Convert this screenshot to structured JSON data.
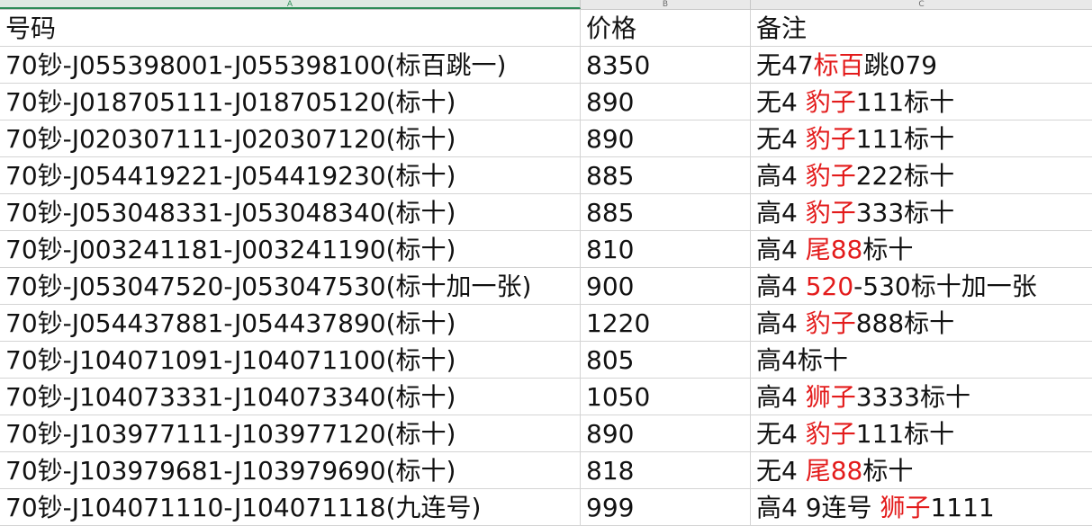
{
  "column_headers": [
    "A",
    "B",
    "C"
  ],
  "header_row": {
    "number": "号码",
    "price": "价格",
    "note": "备注"
  },
  "rows": [
    {
      "number": "70钞-J055398001-J055398100(标百跳一)",
      "price": "8350",
      "note": [
        {
          "t": "无47",
          "red": false
        },
        {
          "t": "标百",
          "red": true
        },
        {
          "t": "跳079",
          "red": false
        }
      ]
    },
    {
      "number": "70钞-J018705111-J018705120(标十)",
      "price": "890",
      "note": [
        {
          "t": "无4 ",
          "red": false
        },
        {
          "t": "豹子",
          "red": true
        },
        {
          "t": "111标十",
          "red": false
        }
      ]
    },
    {
      "number": "70钞-J020307111-J020307120(标十)",
      "price": "890",
      "note": [
        {
          "t": "无4 ",
          "red": false
        },
        {
          "t": "豹子",
          "red": true
        },
        {
          "t": "111标十",
          "red": false
        }
      ]
    },
    {
      "number": "70钞-J054419221-J054419230(标十)",
      "price": "885",
      "note": [
        {
          "t": "高4 ",
          "red": false
        },
        {
          "t": "豹子",
          "red": true
        },
        {
          "t": "222标十",
          "red": false
        }
      ]
    },
    {
      "number": "70钞-J053048331-J053048340(标十)",
      "price": "885",
      "note": [
        {
          "t": "高4 ",
          "red": false
        },
        {
          "t": "豹子",
          "red": true
        },
        {
          "t": "333标十",
          "red": false
        }
      ]
    },
    {
      "number": "70钞-J003241181-J003241190(标十)",
      "price": "810",
      "note": [
        {
          "t": "高4 ",
          "red": false
        },
        {
          "t": "尾88",
          "red": true
        },
        {
          "t": "标十",
          "red": false
        }
      ]
    },
    {
      "number": "70钞-J053047520-J053047530(标十加一张)",
      "price": "900",
      "note": [
        {
          "t": "高4 ",
          "red": false
        },
        {
          "t": "520",
          "red": true
        },
        {
          "t": "-530标十加一张",
          "red": false
        }
      ]
    },
    {
      "number": "70钞-J054437881-J054437890(标十)",
      "price": "1220",
      "note": [
        {
          "t": "高4 ",
          "red": false
        },
        {
          "t": "豹子",
          "red": true
        },
        {
          "t": "888标十",
          "red": false
        }
      ]
    },
    {
      "number": "70钞-J104071091-J104071100(标十)",
      "price": "805",
      "note": [
        {
          "t": "高4标十",
          "red": false
        }
      ]
    },
    {
      "number": "70钞-J104073331-J104073340(标十)",
      "price": "1050",
      "note": [
        {
          "t": "高4 ",
          "red": false
        },
        {
          "t": "狮子",
          "red": true
        },
        {
          "t": "3333标十",
          "red": false
        }
      ]
    },
    {
      "number": "70钞-J103977111-J103977120(标十)",
      "price": "890",
      "note": [
        {
          "t": "无4 ",
          "red": false
        },
        {
          "t": "豹子",
          "red": true
        },
        {
          "t": "111标十",
          "red": false
        }
      ]
    },
    {
      "number": "70钞-J103979681-J103979690(标十)",
      "price": "818",
      "note": [
        {
          "t": "无4 ",
          "red": false
        },
        {
          "t": "尾88",
          "red": true
        },
        {
          "t": "标十",
          "red": false
        }
      ]
    },
    {
      "number": "70钞-J104071110-J104071118(九连号)",
      "price": "999",
      "note": [
        {
          "t": "高4 9连号 ",
          "red": false
        },
        {
          "t": "狮子",
          "red": true
        },
        {
          "t": "1111",
          "red": false
        }
      ]
    }
  ],
  "colors": {
    "accent_red": "#e31b1b",
    "active_column": "#2e8b57"
  }
}
